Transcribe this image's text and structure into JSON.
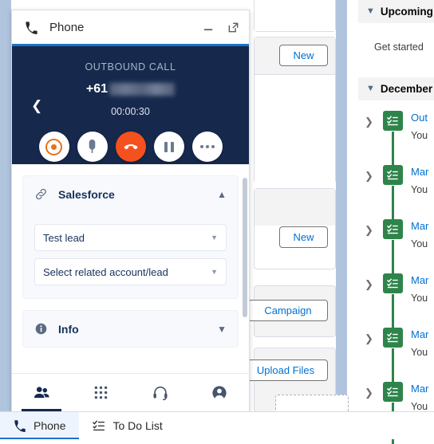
{
  "background": {
    "middle_column": {
      "buttons": [
        {
          "label": "New"
        },
        {
          "label": "New"
        },
        {
          "label": "Campaign"
        },
        {
          "label": "Upload Files"
        }
      ]
    },
    "right_column": {
      "sections": [
        {
          "label": "Upcoming",
          "icon": "chevron-down-icon"
        },
        {
          "label": "December",
          "icon": "chevron-down-icon"
        }
      ],
      "get_started_text": "Get started",
      "timeline": [
        {
          "title": "Out",
          "subtitle": "You",
          "icon": "task-icon"
        },
        {
          "title": "Mar",
          "subtitle": "You",
          "icon": "task-icon"
        },
        {
          "title": "Mar",
          "subtitle": "You",
          "icon": "task-icon"
        },
        {
          "title": "Mar",
          "subtitle": "You",
          "icon": "task-icon"
        },
        {
          "title": "Mar",
          "subtitle": "You",
          "icon": "task-icon"
        },
        {
          "title": "Mar",
          "subtitle": "You",
          "icon": "task-icon"
        }
      ]
    }
  },
  "phone_widget": {
    "header": {
      "title": "Phone",
      "phone_icon": "phone-icon",
      "minimize_label": "minimize-icon",
      "popout_label": "popout-icon"
    },
    "call": {
      "back_icon": "chevron-left-icon",
      "status": "OUTBOUND CALL",
      "country_code": "+61",
      "number_masked": "",
      "duration": "00:00:30",
      "controls": [
        {
          "name": "record-button",
          "icon": "record-icon"
        },
        {
          "name": "mute-button",
          "icon": "mute-icon"
        },
        {
          "name": "hangup-button",
          "icon": "hangup-icon"
        },
        {
          "name": "hold-button",
          "icon": "pause-icon"
        },
        {
          "name": "more-button",
          "icon": "more-icon"
        }
      ]
    },
    "salesforce_panel": {
      "icon": "link-icon",
      "title": "Salesforce",
      "collapse_icon": "chevron-up-icon",
      "selects": [
        {
          "value": "Test lead",
          "name": "lead-select"
        },
        {
          "value": "Select related account/lead",
          "name": "related-account-select"
        }
      ]
    },
    "info_panel": {
      "icon": "info-icon",
      "title": "Info",
      "expand_icon": "chevron-down-icon"
    },
    "nav": [
      {
        "name": "contacts-tab",
        "icon": "contacts-icon",
        "active": true
      },
      {
        "name": "dialpad-tab",
        "icon": "dialpad-icon",
        "active": false
      },
      {
        "name": "headset-tab",
        "icon": "headset-icon",
        "active": false
      },
      {
        "name": "profile-tab",
        "icon": "profile-icon",
        "active": false
      }
    ]
  },
  "taskbar": {
    "items": [
      {
        "label": "Phone",
        "icon": "phone-icon",
        "active": true
      },
      {
        "label": "To Do List",
        "icon": "checklist-icon",
        "active": false
      }
    ]
  },
  "colors": {
    "call_bg": "#16294d",
    "accent_blue": "#1a73c8",
    "hangup": "#f4511e",
    "record": "#e8701a",
    "link_blue": "#0070d2",
    "timeline_green": "#2e844a"
  }
}
